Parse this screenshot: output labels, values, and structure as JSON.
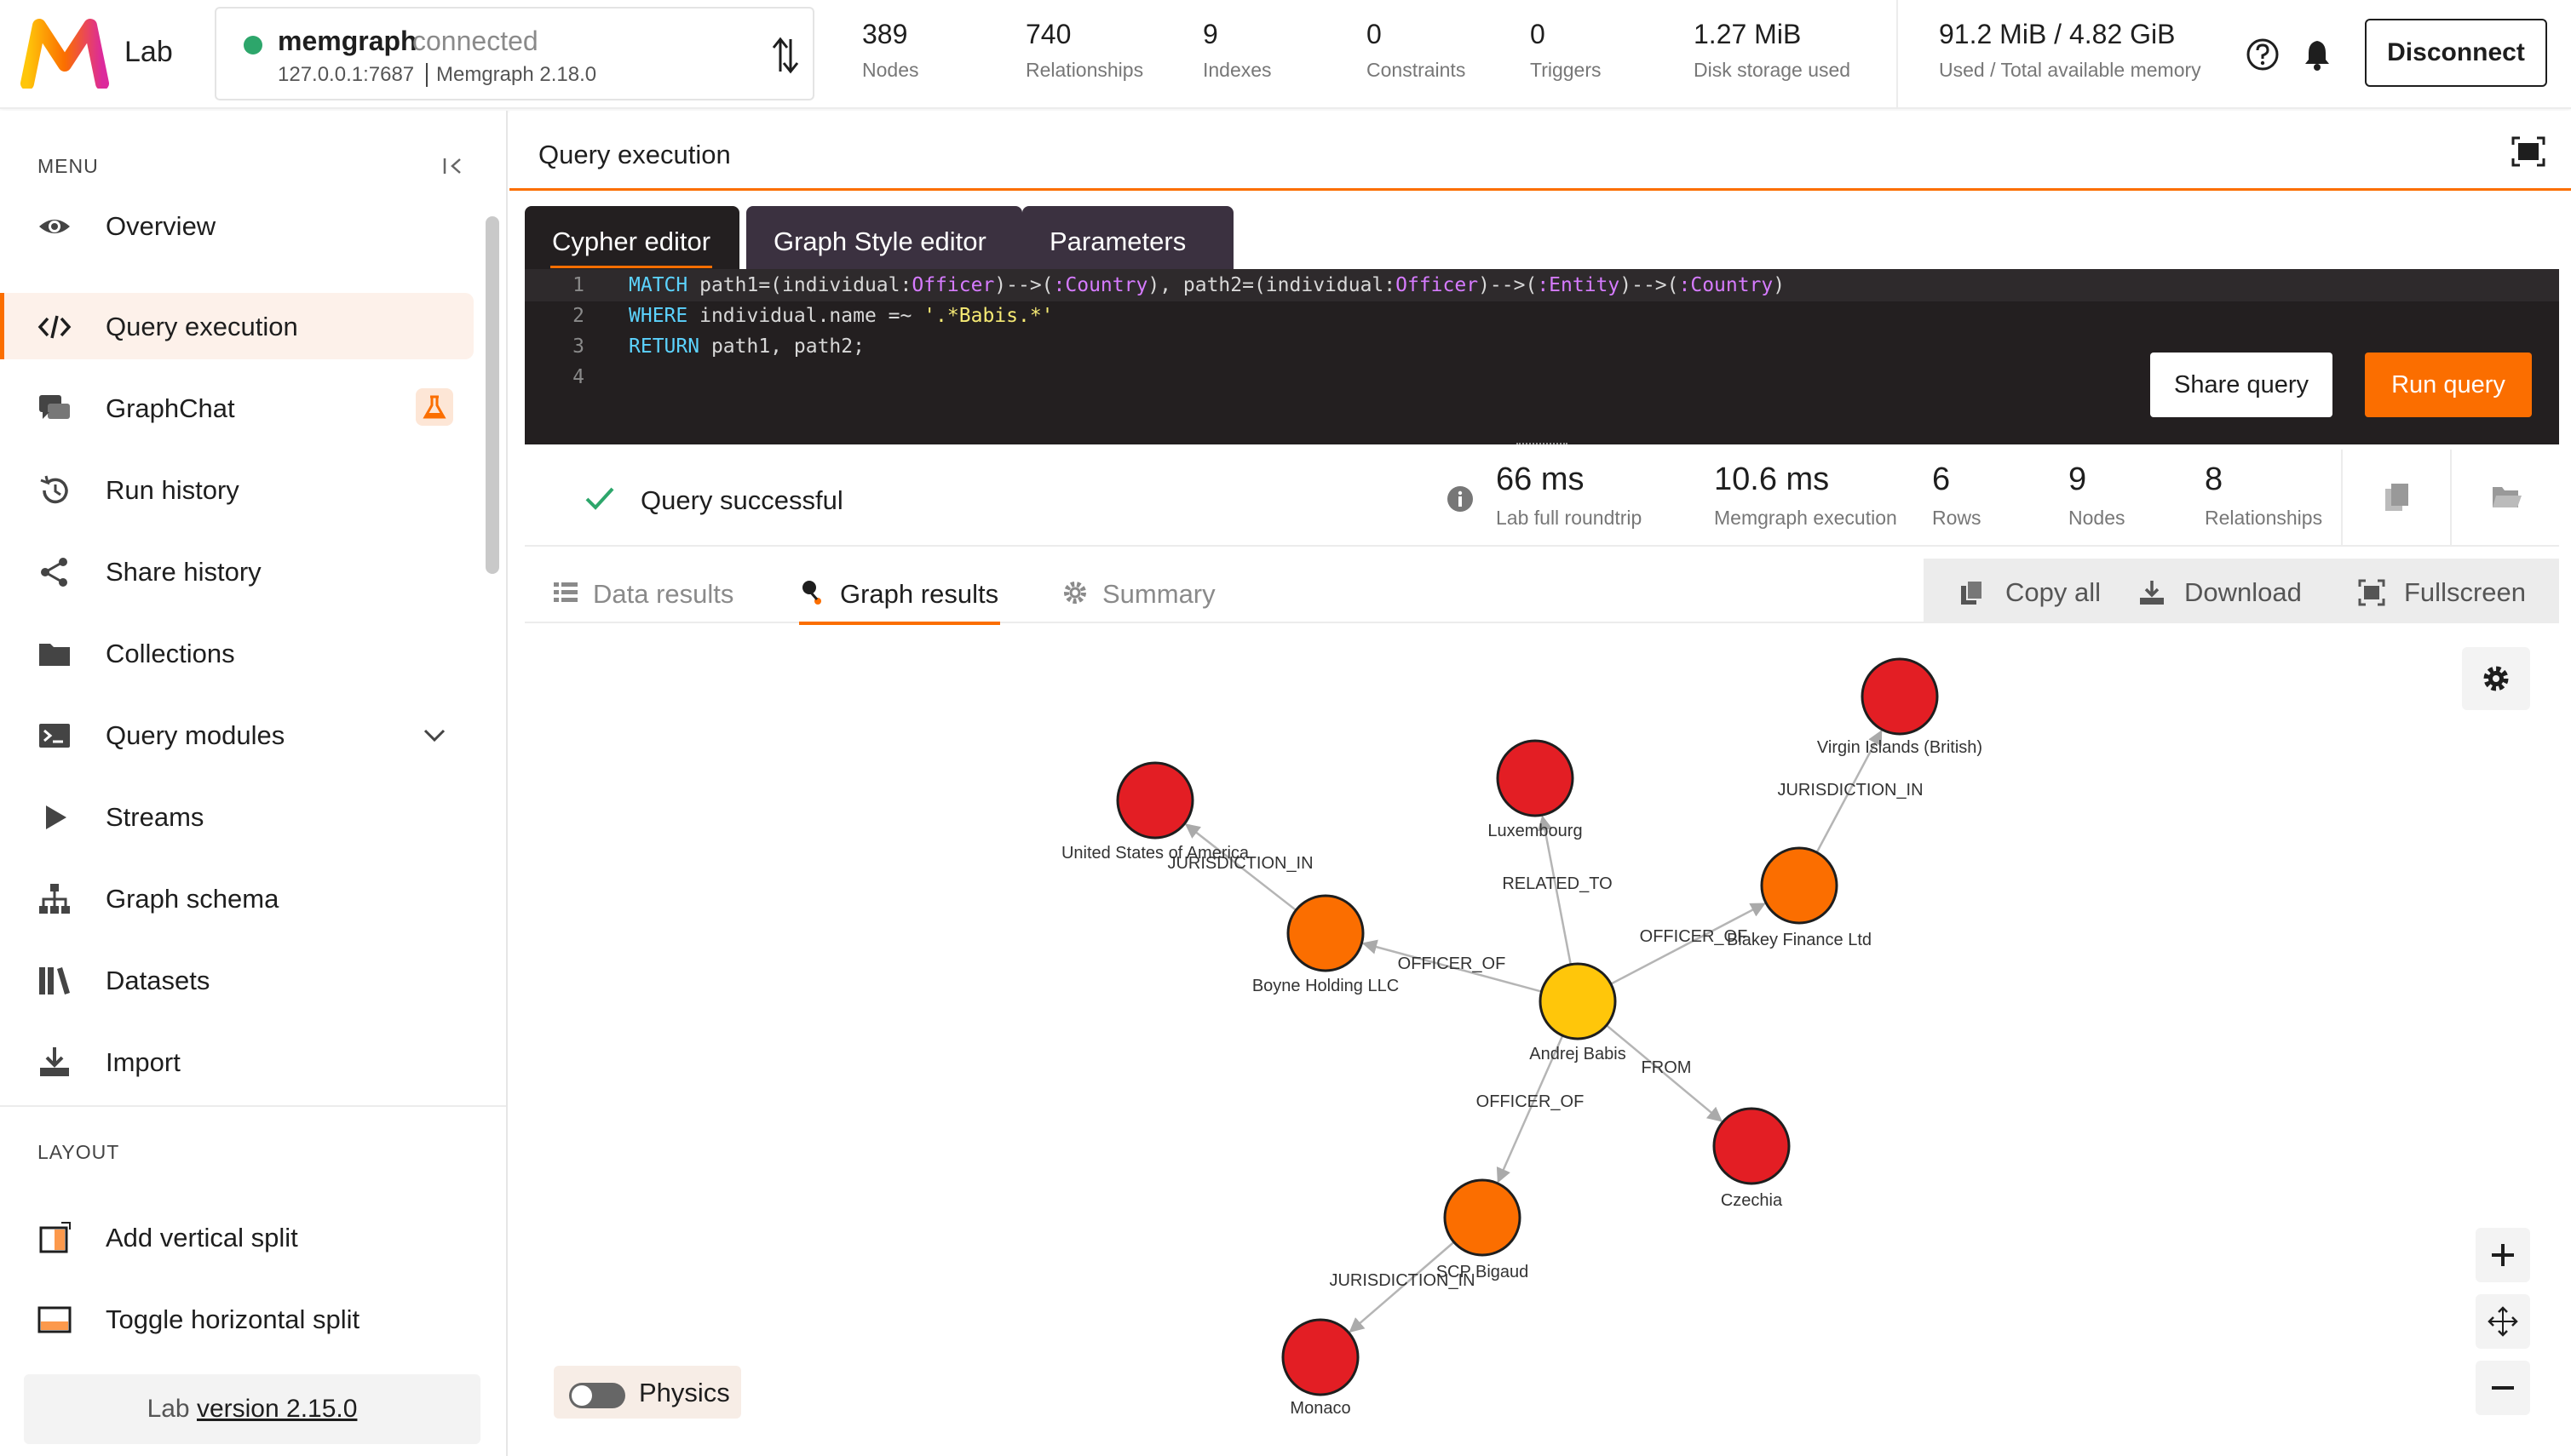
{
  "app": {
    "logo_label": "Lab"
  },
  "connection": {
    "name": "memgraph",
    "status": "connected",
    "host": "127.0.0.1:7687",
    "version": "Memgraph 2.18.0",
    "status_color": "#2da66b"
  },
  "stats": [
    {
      "value": "389",
      "label": "Nodes"
    },
    {
      "value": "740",
      "label": "Relationships"
    },
    {
      "value": "9",
      "label": "Indexes"
    },
    {
      "value": "0",
      "label": "Constraints"
    },
    {
      "value": "0",
      "label": "Triggers"
    },
    {
      "value": "1.27 MiB",
      "label": "Disk storage used"
    }
  ],
  "memory": {
    "value": "91.2 MiB / 4.82 GiB",
    "label": "Used / Total available memory"
  },
  "topbar": {
    "disconnect_label": "Disconnect",
    "help_icon": "help-icon",
    "bell_icon": "bell-icon"
  },
  "sidebar": {
    "menu_title": "MENU",
    "items": [
      {
        "label": "Overview",
        "icon": "eye-icon"
      },
      {
        "label": "Query execution",
        "icon": "code-icon"
      },
      {
        "label": "GraphChat",
        "icon": "chat-icon"
      },
      {
        "label": "Run history",
        "icon": "history-icon"
      },
      {
        "label": "Share history",
        "icon": "share-icon"
      },
      {
        "label": "Collections",
        "icon": "folder-icon"
      },
      {
        "label": "Query modules",
        "icon": "terminal-icon"
      },
      {
        "label": "Streams",
        "icon": "play-icon"
      },
      {
        "label": "Graph schema",
        "icon": "schema-icon"
      },
      {
        "label": "Datasets",
        "icon": "books-icon"
      },
      {
        "label": "Import",
        "icon": "download-icon"
      }
    ],
    "active_index": 1,
    "layout_title": "LAYOUT",
    "layout_items": [
      {
        "label": "Add vertical split",
        "icon": "vertical-split-icon"
      },
      {
        "label": "Toggle horizontal split",
        "icon": "horizontal-split-icon"
      }
    ],
    "version_prefix": "Lab",
    "version_link": "version 2.15.0"
  },
  "main": {
    "title": "Query execution",
    "editor_tabs": [
      "Cypher editor",
      "Graph Style editor",
      "Parameters"
    ],
    "active_editor_tab": 0,
    "code_line_numbers": [
      "1",
      "2",
      "3",
      "4"
    ],
    "share_label": "Share query",
    "run_label": "Run query",
    "accent_color": "#fb6e00"
  },
  "status": {
    "text": "Query successful",
    "metrics": [
      {
        "value": "66 ms",
        "label": "Lab full roundtrip"
      },
      {
        "value": "10.6 ms",
        "label": "Memgraph execution"
      },
      {
        "value": "6",
        "label": "Rows"
      },
      {
        "value": "9",
        "label": "Nodes"
      },
      {
        "value": "8",
        "label": "Relationships"
      }
    ]
  },
  "results": {
    "tabs": [
      {
        "label": "Data results",
        "icon": "table-icon"
      },
      {
        "label": "Graph results",
        "icon": "graph-icon"
      },
      {
        "label": "Summary",
        "icon": "gear-icon"
      }
    ],
    "active_tab": 1,
    "actions": [
      {
        "label": "Copy all",
        "icon": "copy-icon"
      },
      {
        "label": "Download",
        "icon": "download-icon"
      },
      {
        "label": "Fullscreen",
        "icon": "fullscreen-icon"
      }
    ]
  },
  "graph": {
    "physics_label": "Physics",
    "physics_on": false,
    "node_colors": {
      "officer": "#ffc60a",
      "entity": "#fb6e00",
      "country": "#e31e24"
    },
    "nodes": [
      {
        "id": "andrej",
        "label": "Andrej Babis",
        "kind": "officer"
      },
      {
        "id": "boyne",
        "label": "Boyne Holding LLC",
        "kind": "entity"
      },
      {
        "id": "blakey",
        "label": "Blakey Finance Ltd",
        "kind": "entity"
      },
      {
        "id": "scp",
        "label": "SCP Bigaud",
        "kind": "entity"
      },
      {
        "id": "usa",
        "label": "United States of America",
        "kind": "country"
      },
      {
        "id": "lux",
        "label": "Luxembourg",
        "kind": "country"
      },
      {
        "id": "vib",
        "label": "Virgin Islands (British)",
        "kind": "country"
      },
      {
        "id": "cze",
        "label": "Czechia",
        "kind": "country"
      },
      {
        "id": "mon",
        "label": "Monaco",
        "kind": "country"
      }
    ],
    "edges": [
      {
        "from": "andrej",
        "to": "boyne",
        "label": "OFFICER_OF"
      },
      {
        "from": "andrej",
        "to": "blakey",
        "label": "OFFICER_OF"
      },
      {
        "from": "andrej",
        "to": "scp",
        "label": "OFFICER_OF"
      },
      {
        "from": "andrej",
        "to": "lux",
        "label": "RELATED_TO"
      },
      {
        "from": "andrej",
        "to": "cze",
        "label": "FROM"
      },
      {
        "from": "boyne",
        "to": "usa",
        "label": "JURISDICTION_IN"
      },
      {
        "from": "blakey",
        "to": "vib",
        "label": "JURISDICTION_IN"
      },
      {
        "from": "scp",
        "to": "mon",
        "label": "JURISDICTION_IN"
      }
    ]
  }
}
